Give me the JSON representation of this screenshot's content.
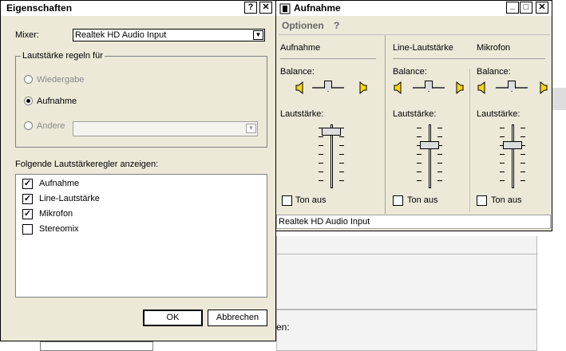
{
  "properties_dialog": {
    "title": "Eigenschaften",
    "help_btn": "?",
    "close_btn": "✕",
    "mixer_label": "Mixer:",
    "mixer_value": "Realtek HD Audio Input",
    "volume_group_title": "Lautstärke regeln für",
    "radio_playback": "Wiedergabe",
    "radio_recording": "Aufnahme",
    "radio_other": "Andere",
    "selected_radio": "Aufnahme",
    "controls_label": "Folgende Lautstärkeregler anzeigen:",
    "controls": [
      {
        "label": "Aufnahme",
        "checked": true
      },
      {
        "label": "Line-Lautstärke",
        "checked": true
      },
      {
        "label": "Mikrofon",
        "checked": true
      },
      {
        "label": "Stereomix",
        "checked": false
      }
    ],
    "ok_label": "OK",
    "cancel_label": "Abbrechen"
  },
  "mixer_window": {
    "title": "Aufnahme",
    "menu": [
      "Optionen",
      "?"
    ],
    "window_buttons": {
      "minimize": "_",
      "maximize": "□",
      "close": "✕"
    },
    "balance_label": "Balance:",
    "volume_label": "Lautstärke:",
    "mute_label": "Ton aus",
    "columns": [
      {
        "title": "Aufnahme",
        "volume_level": 0.95,
        "muted": false
      },
      {
        "title": "Line-Lautstärke",
        "volume_level": 0.7,
        "muted": false
      },
      {
        "title": "Mikrofon",
        "volume_level": 0.7,
        "muted": false
      }
    ],
    "status": "Realtek HD Audio Input"
  },
  "background_page": {
    "partial_label": "en:"
  }
}
